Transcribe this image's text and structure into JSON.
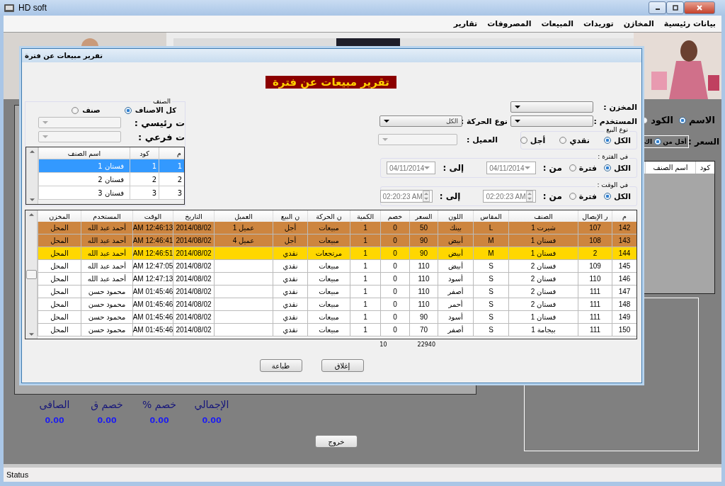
{
  "window": {
    "title": "HD soft"
  },
  "menu": [
    "بيانات رئيسية",
    "المخازن",
    "توريدات",
    "المبيعات",
    "المصروفات",
    "تقارير"
  ],
  "main_form": {
    "search_by": [
      {
        "label": "الاسم",
        "selected": true
      },
      {
        "label": "الكود",
        "selected": false
      }
    ],
    "price_label": "السعر :",
    "price_filter": {
      "label": "أقل من",
      "selected": true
    },
    "price_next": "اك",
    "items_columns": [
      "كود",
      "اسم الصنف"
    ],
    "totals": [
      {
        "label": "الإجمالي",
        "value": "0.00"
      },
      {
        "label": "خصم %",
        "value": "0.00"
      },
      {
        "label": "خصم ق",
        "value": "0.00"
      },
      {
        "label": "الصافى",
        "value": "0.00"
      }
    ],
    "exit_button": "خروج"
  },
  "dialog": {
    "title": "تقرير مبيعات عن فترة",
    "heading": "تقرير مبيعات عن فترة",
    "store": {
      "label": "المخزن  :"
    },
    "user": {
      "label": "المستخدم :"
    },
    "movement": {
      "label": "نوع الحركة :",
      "value": "الكل"
    },
    "sale_type": {
      "legend": "نوع البيع",
      "options": [
        {
          "label": "الكل",
          "selected": true
        },
        {
          "label": "نقدي",
          "selected": false
        },
        {
          "label": "أجل",
          "selected": false
        }
      ]
    },
    "customer": {
      "label": "العميل :",
      "disabled": true
    },
    "period": {
      "legend": "في الفترة :",
      "options": [
        {
          "label": "الكل",
          "selected": true
        },
        {
          "label": "فترة",
          "selected": false
        }
      ],
      "from_label": "من :",
      "from": "04/11/2014",
      "to_label": "إلى :",
      "to": "04/11/2014",
      "disabled": true,
      "kind": "date"
    },
    "time": {
      "legend": "في الوقت :",
      "options": [
        {
          "label": "الكل",
          "selected": true
        },
        {
          "label": "فترة",
          "selected": false
        }
      ],
      "from_label": "من :",
      "from": "02:20:23 AM",
      "to_label": "إلى :",
      "to": "02:20:23 AM",
      "disabled": true,
      "kind": "time"
    },
    "category": {
      "legend": "الصنف",
      "options": [
        {
          "label": "كل الاصناف",
          "selected": true
        },
        {
          "label": "صنف",
          "selected": false
        }
      ],
      "main_label": "ت رئيسي :",
      "sub_label": "ت فرعي :",
      "columns": [
        "م",
        "كود",
        "اسم الصنف"
      ],
      "rows": [
        {
          "cells": [
            "1",
            "1",
            "فستان 1"
          ],
          "selected": true
        },
        {
          "cells": [
            "2",
            "2",
            "فستان 2"
          ],
          "selected": false
        },
        {
          "cells": [
            "3",
            "3",
            "فستان 3"
          ],
          "selected": false
        }
      ]
    },
    "table": {
      "columns": [
        "م",
        "ر الإيصال",
        "الصنف",
        "المقاس",
        "اللون",
        "السعر",
        "خصم",
        "الكمية",
        "ن الحركة",
        "ن البيع",
        "العميل",
        "التاريخ",
        "الوقت",
        "المستخدم",
        "المخزن"
      ],
      "rows": [
        {
          "color": "#cd853f",
          "cells": [
            "142",
            "107",
            "شيرت 1",
            "L",
            "بينك",
            "50",
            "0",
            "1",
            "مبيعات",
            "أجل",
            "عميل 1",
            "2014/08/02",
            "AM 12:46:13",
            "أحمد عبد الله",
            "المحل"
          ]
        },
        {
          "color": "#cd853f",
          "cells": [
            "143",
            "108",
            "فستان 1",
            "M",
            "أبيض",
            "90",
            "0",
            "1",
            "مبيعات",
            "أجل",
            "عميل 4",
            "2014/08/02",
            "AM 12:46:41",
            "أحمد عبد الله",
            "المحل"
          ]
        },
        {
          "color": "#ffd700",
          "cells": [
            "144",
            "2",
            "فستان 1",
            "M",
            "أبيض",
            "90",
            "0",
            "1",
            "مرتجعات",
            "نقدي",
            null,
            "2014/08/02",
            "AM 12:46:51",
            "أحمد عبد الله",
            "المحل"
          ]
        },
        {
          "color": "#ffffff",
          "cells": [
            "145",
            "109",
            "فستان 2",
            "S",
            "أبيض",
            "110",
            "0",
            "1",
            "مبيعات",
            "نقدي",
            null,
            "2014/08/02",
            "AM 12:47:05",
            "أحمد عبد الله",
            "المحل"
          ]
        },
        {
          "color": "#ffffff",
          "cells": [
            "146",
            "110",
            "فستان 2",
            "S",
            "أسود",
            "110",
            "0",
            "1",
            "مبيعات",
            "نقدي",
            null,
            "2014/08/02",
            "AM 12:47:13",
            "أحمد عبد الله",
            "المحل"
          ]
        },
        {
          "color": "#ffffff",
          "cells": [
            "147",
            "111",
            "فستان 2",
            "S",
            "أصفر",
            "110",
            "0",
            "1",
            "مبيعات",
            "نقدي",
            null,
            "2014/08/02",
            "AM 01:45:46",
            "محمود حسن",
            "المحل"
          ]
        },
        {
          "color": "#ffffff",
          "cells": [
            "148",
            "111",
            "فستان 2",
            "S",
            "أحمر",
            "110",
            "0",
            "1",
            "مبيعات",
            "نقدي",
            null,
            "2014/08/02",
            "AM 01:45:46",
            "محمود حسن",
            "المحل"
          ]
        },
        {
          "color": "#ffffff",
          "cells": [
            "149",
            "111",
            "فستان 1",
            "S",
            "أسود",
            "90",
            "0",
            "1",
            "مبيعات",
            "نقدي",
            null,
            "2014/08/02",
            "AM 01:45:46",
            "محمود حسن",
            "المحل"
          ]
        },
        {
          "color": "#ffffff",
          "cells": [
            "150",
            "111",
            "بيجامة 1",
            "S",
            "أصفر",
            "70",
            "0",
            "1",
            "مبيعات",
            "نقدي",
            null,
            "2014/08/02",
            "AM 01:45:46",
            "محمود حسن",
            "المحل"
          ]
        }
      ],
      "total_quantity": "10",
      "total_price": "22940"
    },
    "buttons": [
      "إغلاق",
      "طباعة"
    ]
  },
  "status_bar": "Status"
}
